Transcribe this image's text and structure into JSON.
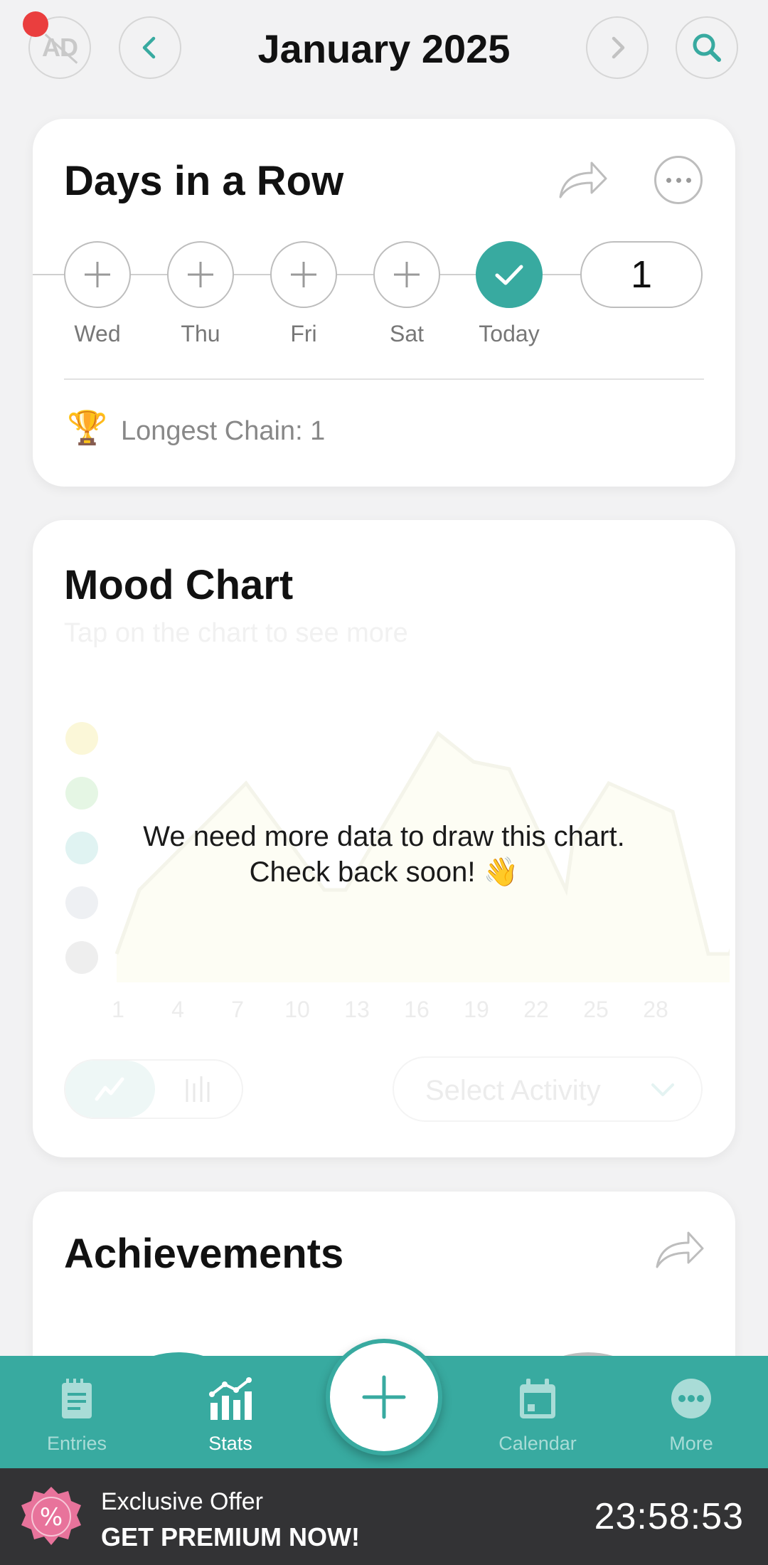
{
  "header": {
    "ad_label": "AD",
    "title": "January 2025",
    "icons": [
      "ad-block-icon",
      "chevron-left-icon",
      "chevron-right-icon",
      "search-icon"
    ]
  },
  "streak": {
    "title": "Days in a Row",
    "days": [
      {
        "label": "Wed",
        "done": false
      },
      {
        "label": "Thu",
        "done": false
      },
      {
        "label": "Fri",
        "done": false
      },
      {
        "label": "Sat",
        "done": false
      },
      {
        "label": "Today",
        "done": true
      }
    ],
    "count": "1",
    "longest_chain": "Longest Chain: 1",
    "trophy_icon": "🏆"
  },
  "mood": {
    "title": "Mood Chart",
    "subtitle": "Tap on the chart to see more",
    "empty_line1": "We need more data to draw this chart.",
    "empty_line2": "Check back soon! 👋",
    "x_labels": [
      "1",
      "4",
      "7",
      "10",
      "13",
      "16",
      "19",
      "22",
      "25",
      "28"
    ],
    "activity_placeholder": "Select Activity"
  },
  "achievements": {
    "title": "Achievements"
  },
  "nav": {
    "items": [
      {
        "label": "Entries",
        "icon": "notepad-icon"
      },
      {
        "label": "Stats",
        "icon": "stats-icon"
      },
      {
        "label": "Calendar",
        "icon": "calendar-icon"
      },
      {
        "label": "More",
        "icon": "more-dots-icon"
      }
    ],
    "active": "Stats"
  },
  "promo": {
    "line1": "Exclusive Offer",
    "line2": "GET PREMIUM NOW!",
    "timer": "23:58:53",
    "badge_symbol": "%"
  },
  "colors": {
    "accent": "#38aaa0",
    "promo_bg": "#333335",
    "notification_dot": "#ea3e3e"
  }
}
